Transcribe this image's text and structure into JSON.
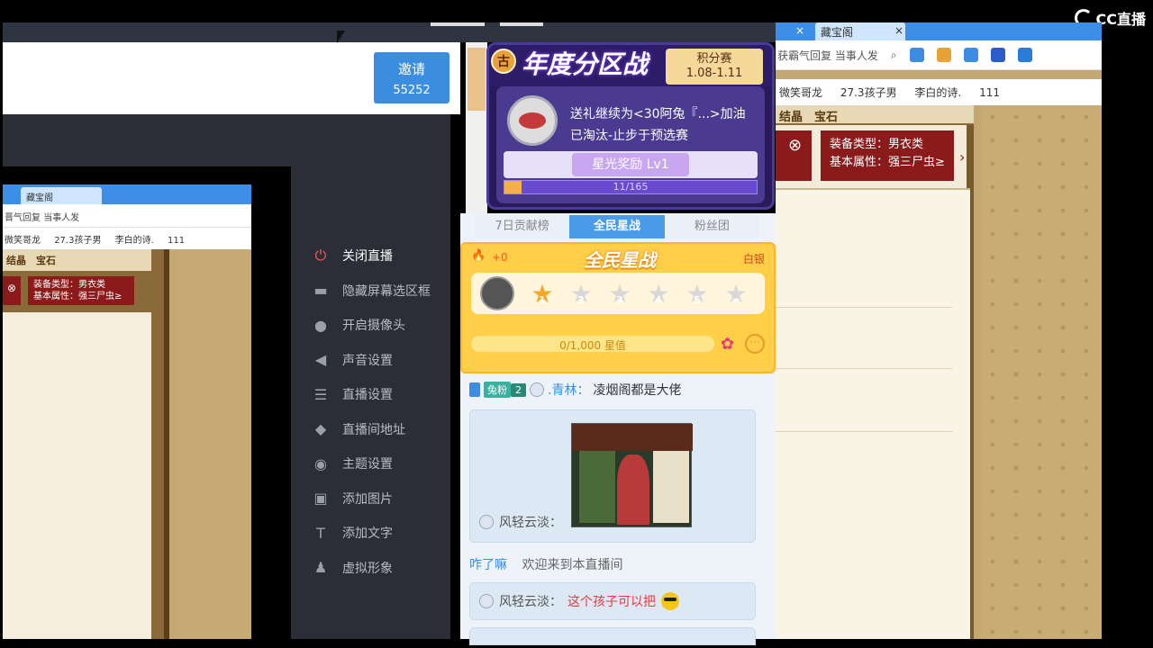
{
  "watermark": "CC直播",
  "header": {
    "invite_label": "邀请",
    "invite_id": "55252"
  },
  "preview": {
    "tab_label": "藏宝阁",
    "address_text": "晋气回复 当事人发",
    "bookmarks": [
      "微笑哥龙",
      "27.3孩子男",
      "李白的诗.",
      "111"
    ],
    "heading": "结晶　宝石",
    "close_glyph": "⊗",
    "tip_line1": "装备类型：男衣类",
    "tip_line2": "基本属性：强三尸虫≥"
  },
  "menu": {
    "items": [
      {
        "label": "关闭直播",
        "icon": "power-icon",
        "glyph": "⏻"
      },
      {
        "label": "隐藏屏幕选区框",
        "icon": "monitor-icon",
        "glyph": "▬"
      },
      {
        "label": "开启摄像头",
        "icon": "camera-pin-icon",
        "glyph": "●"
      },
      {
        "label": "声音设置",
        "icon": "speaker-icon",
        "glyph": "◀"
      },
      {
        "label": "直播设置",
        "icon": "sliders-icon",
        "glyph": "☰"
      },
      {
        "label": "直播间地址",
        "icon": "location-icon",
        "glyph": "◆"
      },
      {
        "label": "主题设置",
        "icon": "palette-icon",
        "glyph": "◉"
      },
      {
        "label": "添加图片",
        "icon": "image-icon",
        "glyph": "▣"
      },
      {
        "label": "添加文字",
        "icon": "text-icon",
        "glyph": "T"
      },
      {
        "label": "虚拟形象",
        "icon": "avatar-icon",
        "glyph": "♟"
      }
    ]
  },
  "banner": {
    "badge": "古",
    "title": "年度分区战",
    "tag_line1": "积分赛",
    "tag_line2": "1.08-1.11",
    "line1": "送礼继续为<30阿兔『...>加油",
    "line2": "已淘汰-止步于预选赛",
    "reward": "星光奖励 Lv1",
    "progress_text": "11/165",
    "progress_value": 11,
    "progress_max": 165
  },
  "chat": {
    "tabs": [
      "7日贡献榜",
      "全民星战",
      "粉丝团"
    ],
    "active_tab": 1,
    "star_card": {
      "title": "全民星战",
      "delta": "+0",
      "rank": "白银",
      "stars": [
        "1",
        "2",
        "3",
        "4",
        "5",
        "∞"
      ],
      "stars_on": 1,
      "progress_text": "0/1,000 星值",
      "more_glyph": "···"
    },
    "msg1": {
      "fan_badge": "兔粉",
      "level": "2",
      "user": ".青林：",
      "text": "凌烟阁都是大佬"
    },
    "img_msg": {
      "sender": "风轻云淡："
    },
    "welcome": {
      "user": "咋了嘛",
      "text": "欢迎来到本直播间"
    },
    "msg3": {
      "sender": "风轻云淡：",
      "text": "这个孩子可以把"
    }
  },
  "rbrowser": {
    "tabs": [
      "×",
      "藏宝阁",
      "×"
    ],
    "address_text": "获霸气回复 当事人发",
    "bookmarks": [
      "微笑哥龙",
      "27.3孩子男",
      "李白的诗.",
      "111"
    ],
    "heading": "结晶　宝石",
    "close_glyph": "⊗",
    "tip_line1": "装备类型：男衣类",
    "tip_line2": "基本属性：强三尸虫≥",
    "arrow": "›"
  }
}
